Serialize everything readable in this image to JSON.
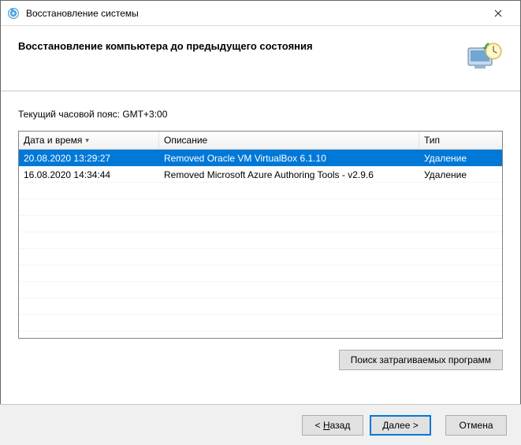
{
  "window": {
    "title": "Восстановление системы"
  },
  "header": {
    "title": "Восстановление компьютера до предыдущего состояния"
  },
  "timezone_line": "Текущий часовой пояс: GMT+3:00",
  "table": {
    "headers": {
      "datetime": "Дата и время",
      "description": "Описание",
      "type": "Тип"
    },
    "rows": [
      {
        "datetime": "20.08.2020 13:29:27",
        "description": "Removed Oracle VM VirtualBox 6.1.10",
        "type": "Удаление",
        "selected": true
      },
      {
        "datetime": "16.08.2020 14:34:44",
        "description": "Removed Microsoft Azure Authoring Tools - v2.9.6",
        "type": "Удаление",
        "selected": false
      }
    ]
  },
  "buttons": {
    "scan": "Поиск затрагиваемых программ",
    "back_pre": "< ",
    "back_u": "Н",
    "back_post": "азад",
    "next_pre": "",
    "next_u": "Д",
    "next_post": "алее >",
    "cancel": "Отмена"
  }
}
